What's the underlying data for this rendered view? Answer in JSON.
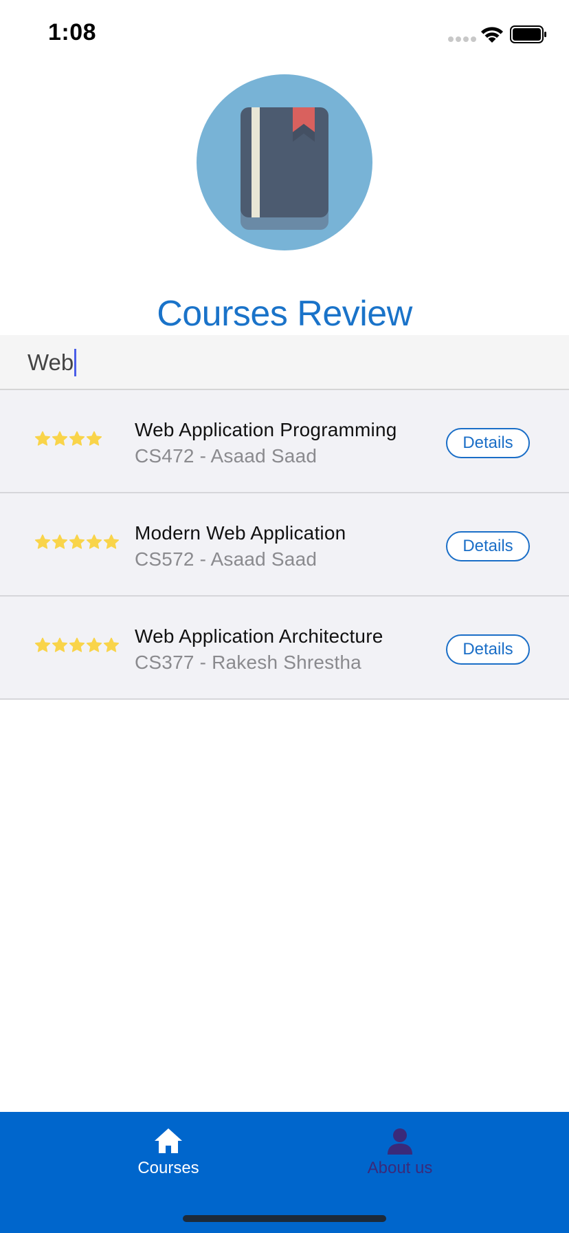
{
  "status_bar": {
    "time": "1:08"
  },
  "header": {
    "title": "Courses Review",
    "logo_icon": "book-icon"
  },
  "search": {
    "value": "Web"
  },
  "colors": {
    "accent": "#1a73c9",
    "tab_bar": "#0066cc",
    "star": "#f9d44a",
    "row_background": "#f2f2f6"
  },
  "courses": [
    {
      "name": "Web Application Programming",
      "subtitle": "CS472 - Asaad Saad",
      "rating": 4,
      "button_label": "Details"
    },
    {
      "name": "Modern Web Application",
      "subtitle": "CS572 - Asaad Saad",
      "rating": 5,
      "button_label": "Details"
    },
    {
      "name": "Web Application Architecture",
      "subtitle": "CS377 - Rakesh Shrestha",
      "rating": 5,
      "button_label": "Details"
    }
  ],
  "tab_bar": {
    "tabs": [
      {
        "label": "Courses",
        "icon": "home-icon",
        "active": true
      },
      {
        "label": "About us",
        "icon": "person-icon",
        "active": false
      }
    ]
  }
}
